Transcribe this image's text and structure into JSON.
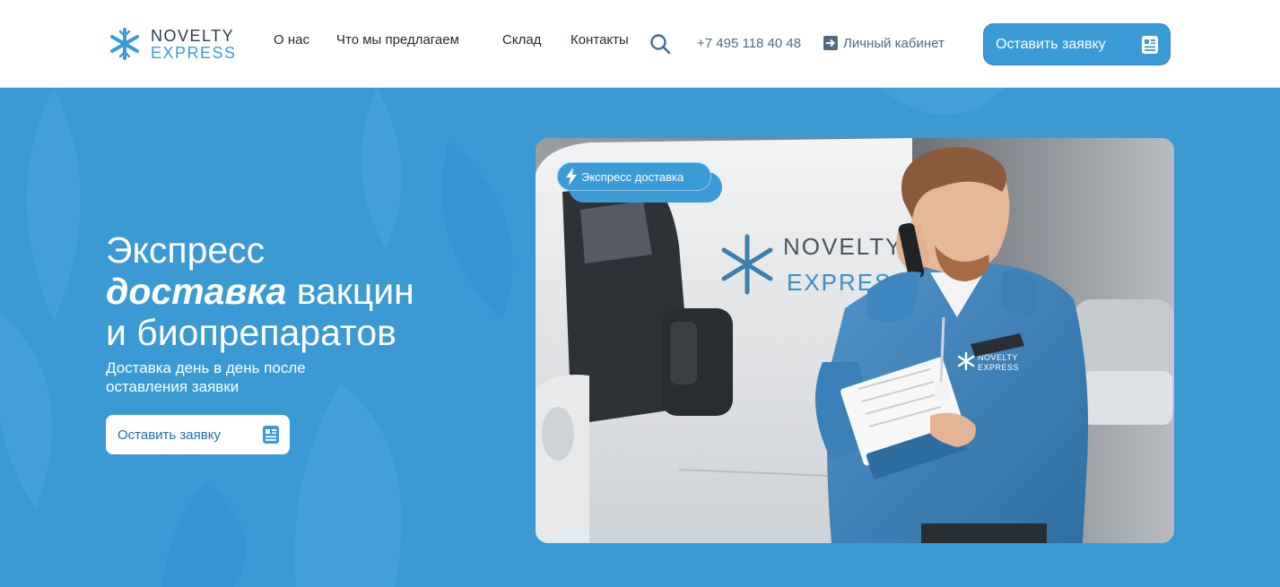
{
  "header": {
    "logo": {
      "line1": "NOVELTY",
      "line2": "EXPRESS"
    },
    "nav": [
      {
        "label": "О нас"
      },
      {
        "label": "Что мы предлагаем"
      },
      {
        "label": "Склад"
      },
      {
        "label": "Контакты"
      }
    ],
    "phone": "+7 495 118 40 48",
    "cabinet_label": "Личный кабинет",
    "cta_label": "Оставить заявку"
  },
  "hero": {
    "title_line1": "Экспресс",
    "title_line2_em": "доставка",
    "title_line2_rest": " вакцин",
    "title_line3": "и биопрепаратов",
    "subtitle": "Доставка день в день после оставления заявки",
    "cta_label": "Оставить заявку",
    "badge_label": "Экспресс доставка",
    "van_logo": {
      "line1": "NOVELTY",
      "line2": "EXPRESS"
    },
    "jacket_logo": {
      "line1": "NOVELTY",
      "line2": "EXPRESS"
    }
  },
  "icons": {
    "logo": "snowflake-logo-icon",
    "search": "search-icon",
    "cabinet": "login-arrow-icon",
    "form": "form-document-icon",
    "badge": "lightning-icon"
  },
  "colors": {
    "brand_blue": "#3b9bd6",
    "hero_background": "#3b9ad4",
    "text_dark": "#1f2a36",
    "text_muted": "#4f6b82",
    "white": "#ffffff"
  }
}
